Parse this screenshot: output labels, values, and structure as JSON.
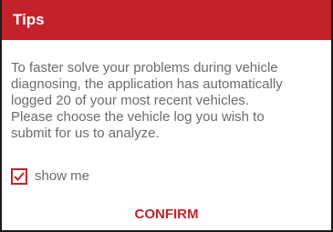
{
  "dialog": {
    "title": "Tips",
    "message_lines": [
      "To faster solve your problems during vehicle",
      "diagnosing, the application has automatically",
      "logged 20 of your most recent vehicles.",
      "Please choose the vehicle log you wish to",
      "submit for us to analyze."
    ],
    "checkbox": {
      "label": "show me",
      "checked": true
    },
    "confirm_label": "CONFIRM"
  },
  "colors": {
    "accent": "#c4222a",
    "text": "#6b6b6b",
    "title_text": "#ffffff"
  },
  "icons": {
    "checkbox_mark": "checkmark-icon"
  }
}
